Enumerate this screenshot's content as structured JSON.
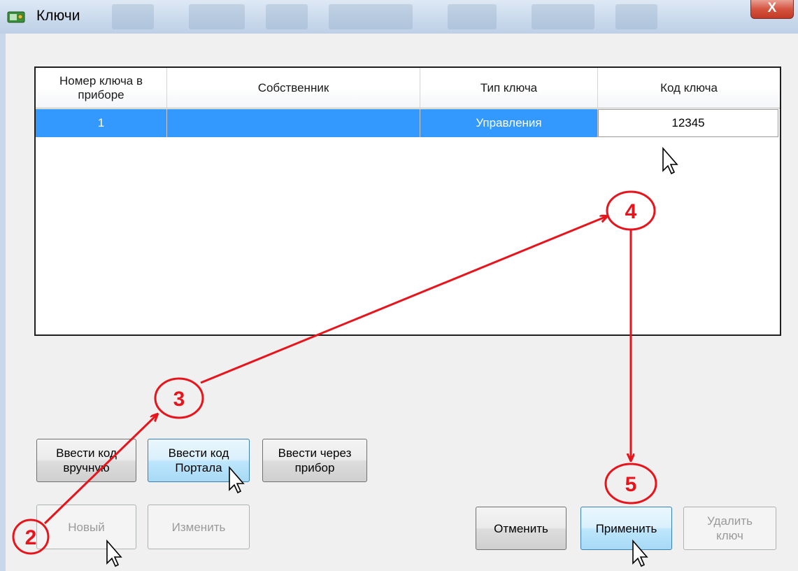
{
  "window": {
    "title": "Ключи",
    "close_glyph": "X"
  },
  "grid": {
    "columns": [
      "Номер ключа в приборе",
      "Собственник",
      "Тип ключа",
      "Код ключа"
    ],
    "rows": [
      {
        "number": "1",
        "owner": "",
        "type": "Управления",
        "code": "12345"
      }
    ],
    "selection_color": "#3399ff"
  },
  "buttons": {
    "enter_manual": "Ввести код вручную",
    "enter_portal": "Ввести код Портала",
    "enter_device": "Ввести через прибор",
    "new": "Новый",
    "edit": "Изменить",
    "cancel": "Отменить",
    "apply": "Применить",
    "delete": "Удалить ключ"
  },
  "annotations": {
    "steps": [
      "2",
      "3",
      "4",
      "5"
    ],
    "color": "#e8141c"
  },
  "icons": [
    "app-icon",
    "close-icon",
    "mouse-cursor-icon"
  ]
}
